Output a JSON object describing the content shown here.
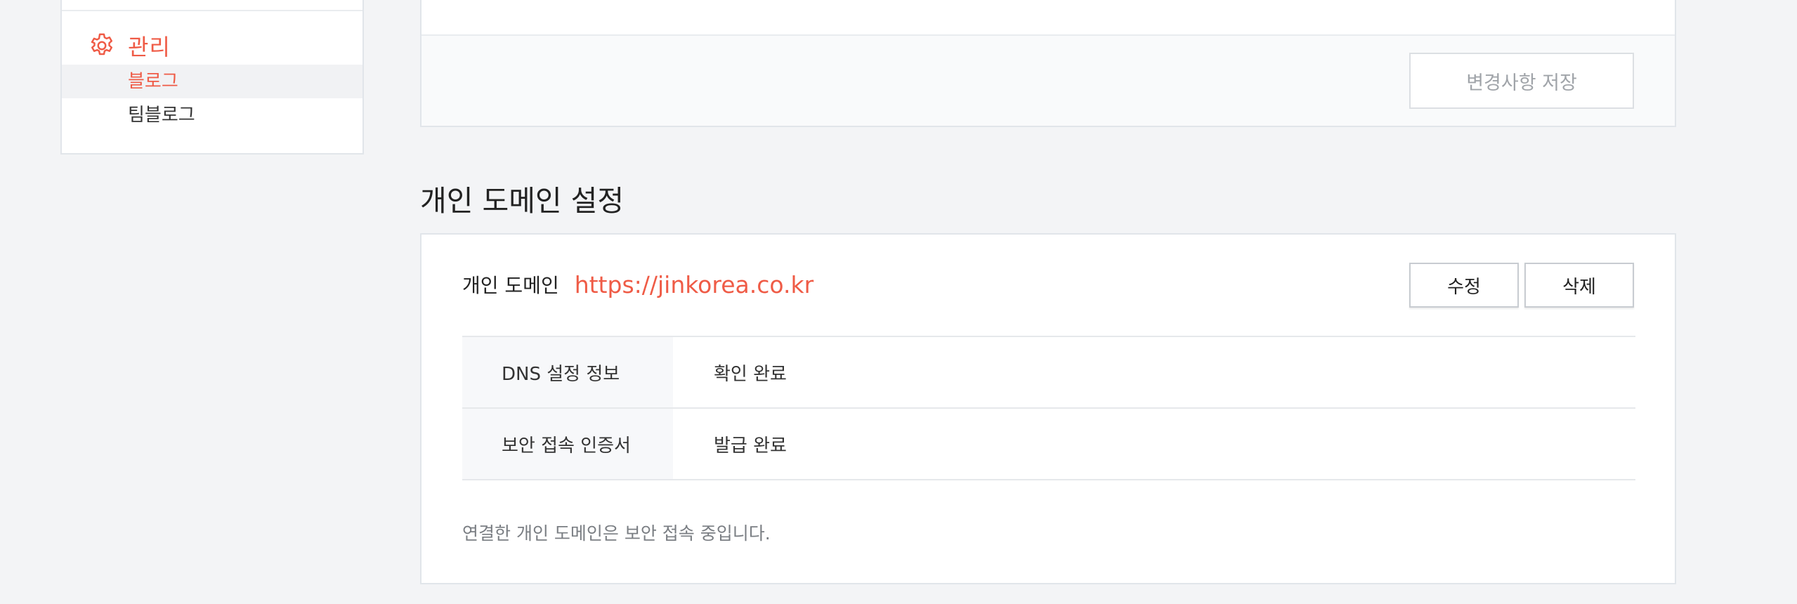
{
  "sidebar": {
    "group": {
      "icon": "gear-icon",
      "label": "관리"
    },
    "items": [
      {
        "label": "블로그",
        "active": true
      },
      {
        "label": "팀블로그",
        "active": false
      }
    ]
  },
  "top_panel": {
    "save_label": "변경사항 저장"
  },
  "domain_section": {
    "title": "개인 도메인 설정",
    "domain_label": "개인 도메인",
    "domain_url": "https://jinkorea.co.kr",
    "edit_label": "수정",
    "delete_label": "삭제",
    "rows": [
      {
        "header": "DNS 설정 정보",
        "value": "확인 완료"
      },
      {
        "header": "보안 접속 인증서",
        "value": "발급 완료"
      }
    ],
    "notice": "연결한 개인 도메인은 보안 접속 중입니다."
  },
  "colors": {
    "accent": "#ef5b46",
    "background": "#f3f4f6",
    "panel": "#ffffff",
    "border": "#e1e5ea"
  }
}
